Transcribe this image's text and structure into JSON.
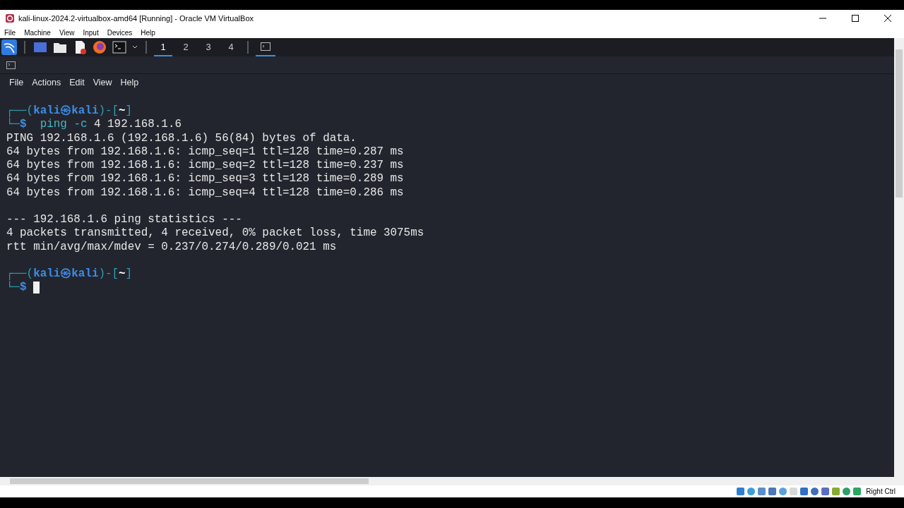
{
  "window": {
    "title": "kali-linux-2024.2-virtualbox-amd64 [Running] - Oracle VM VirtualBox"
  },
  "menu": [
    "File",
    "Machine",
    "View",
    "Input",
    "Devices",
    "Help"
  ],
  "panel": {
    "workspaces": [
      {
        "label": "1",
        "selected": true
      },
      {
        "label": "2",
        "selected": false
      },
      {
        "label": "3",
        "selected": false
      },
      {
        "label": "4",
        "selected": false
      }
    ],
    "tasks": [
      {
        "selected": true
      }
    ]
  },
  "terminal": {
    "menu": [
      "File",
      "Actions",
      "Edit",
      "View",
      "Help"
    ],
    "lines": [
      {
        "kind": "text",
        "segments": [
          {
            "kind": "frame",
            "text": "┌──("
          },
          {
            "kind": "user",
            "text": "kali㉿kali"
          },
          {
            "kind": "frame",
            "text": ")-["
          },
          {
            "kind": "path",
            "text": "~"
          },
          {
            "kind": "frame",
            "text": "]"
          }
        ]
      },
      {
        "kind": "text",
        "segments": [
          {
            "kind": "frame",
            "text": "└─"
          },
          {
            "kind": "user",
            "text": "$"
          },
          {
            "kind": "cmd",
            "text": "  ping -c"
          },
          {
            "kind": "plain",
            "text": " 4 192.168.1.6"
          }
        ]
      },
      {
        "kind": "text",
        "segments": [
          {
            "kind": "plain",
            "text": "PING 192.168.1.6 (192.168.1.6) 56(84) bytes of data."
          }
        ]
      },
      {
        "kind": "text",
        "segments": [
          {
            "kind": "plain",
            "text": "64 bytes from 192.168.1.6: icmp_seq=1 ttl=128 time=0.287 ms"
          }
        ]
      },
      {
        "kind": "text",
        "segments": [
          {
            "kind": "plain",
            "text": "64 bytes from 192.168.1.6: icmp_seq=2 ttl=128 time=0.237 ms"
          }
        ]
      },
      {
        "kind": "text",
        "segments": [
          {
            "kind": "plain",
            "text": "64 bytes from 192.168.1.6: icmp_seq=3 ttl=128 time=0.289 ms"
          }
        ]
      },
      {
        "kind": "text",
        "segments": [
          {
            "kind": "plain",
            "text": "64 bytes from 192.168.1.6: icmp_seq=4 ttl=128 time=0.286 ms"
          }
        ]
      },
      {
        "kind": "blank"
      },
      {
        "kind": "text",
        "segments": [
          {
            "kind": "plain",
            "text": "--- 192.168.1.6 ping statistics ---"
          }
        ]
      },
      {
        "kind": "text",
        "segments": [
          {
            "kind": "plain",
            "text": "4 packets transmitted, 4 received, 0% packet loss, time 3075ms"
          }
        ]
      },
      {
        "kind": "text",
        "segments": [
          {
            "kind": "plain",
            "text": "rtt min/avg/max/mdev = 0.237/0.274/0.289/0.021 ms"
          }
        ]
      },
      {
        "kind": "blank"
      },
      {
        "kind": "text",
        "segments": [
          {
            "kind": "frame",
            "text": "┌──("
          },
          {
            "kind": "user",
            "text": "kali㉿kali"
          },
          {
            "kind": "frame",
            "text": ")-["
          },
          {
            "kind": "path",
            "text": "~"
          },
          {
            "kind": "frame",
            "text": "]"
          }
        ]
      },
      {
        "kind": "text",
        "segments": [
          {
            "kind": "frame",
            "text": "└─"
          },
          {
            "kind": "user",
            "text": "$"
          },
          {
            "kind": "cursor"
          }
        ]
      }
    ]
  },
  "status_bar": {
    "host_key": "Right Ctrl"
  }
}
